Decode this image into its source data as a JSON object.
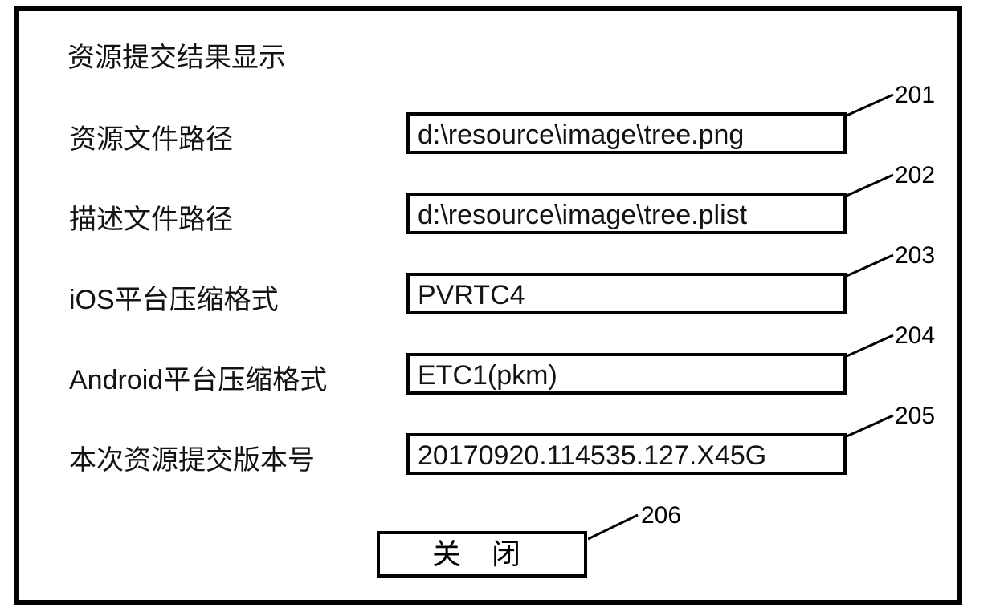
{
  "title": "资源提交结果显示",
  "rows": [
    {
      "label": "资源文件路径",
      "value": "d:\\resource\\image\\tree.png",
      "ref": "201"
    },
    {
      "label": "描述文件路径",
      "value": "d:\\resource\\image\\tree.plist",
      "ref": "202"
    },
    {
      "label": "iOS平台压缩格式",
      "value": "PVRTC4",
      "ref": "203"
    },
    {
      "label": "Android平台压缩格式",
      "value": "ETC1(pkm)",
      "ref": "204"
    },
    {
      "label": "本次资源提交版本号",
      "value": "20170920.114535.127.X45G",
      "ref": "205"
    }
  ],
  "close_btn": {
    "label": "关 闭",
    "ref": "206"
  }
}
